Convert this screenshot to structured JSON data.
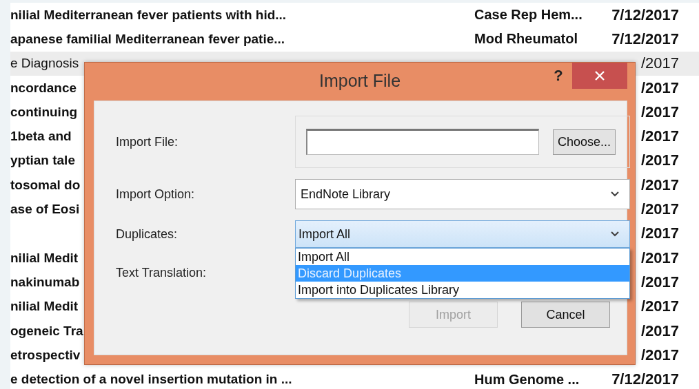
{
  "reference_list": {
    "rows": [
      {
        "title": "nilial Mediterranean fever patients with hid...",
        "journal": "Case Rep Hem...",
        "date": "7/12/2017",
        "selected": false,
        "unread": true
      },
      {
        "title": "apanese familial Mediterranean fever patie...",
        "journal": "Mod Rheumatol",
        "date": "7/12/2017",
        "selected": false,
        "unread": true
      },
      {
        "title": "e Diagnosis",
        "date": "/2017",
        "selected": true,
        "unread": false
      },
      {
        "title": "ncordance",
        "date": "/2017",
        "selected": false,
        "unread": true
      },
      {
        "title": "continuing",
        "date": "/2017",
        "selected": false,
        "unread": true
      },
      {
        "title": "1beta and",
        "date": "/2017",
        "selected": false,
        "unread": true
      },
      {
        "title": "yptian tale",
        "date": "/2017",
        "selected": false,
        "unread": true
      },
      {
        "title": "tosomal do",
        "date": "/2017",
        "selected": false,
        "unread": true
      },
      {
        "title": "ase of Eosi",
        "date": "/2017",
        "selected": false,
        "unread": true
      },
      {
        "date": "/2017",
        "selected": false,
        "unread": true
      },
      {
        "title": "nilial Medit",
        "date": "/2017",
        "selected": false,
        "unread": true
      },
      {
        "title": "nakinumab",
        "date": "/2017",
        "selected": false,
        "unread": true
      },
      {
        "title": "nilial Medit",
        "date": "/2017",
        "selected": false,
        "unread": true
      },
      {
        "title": "ogeneic Tra",
        "date": "/2017",
        "selected": false,
        "unread": true
      },
      {
        "title": "etrospectiv",
        "date": "/2017",
        "selected": false,
        "unread": true
      },
      {
        "title": "e detection of a novel insertion mutation in ...",
        "journal": "Hum Genome ...",
        "date": "7/12/2017",
        "selected": false,
        "unread": true
      }
    ]
  },
  "dialog": {
    "title": "Import File",
    "help": "?",
    "import_file": {
      "label": "Import File:",
      "button": "Choose..."
    },
    "import_option": {
      "label": "Import Option:",
      "value": "EndNote Library"
    },
    "duplicates": {
      "label": "Duplicates:",
      "value": "Import All",
      "expanded": true,
      "options": [
        {
          "label": "Import All",
          "highlighted": false
        },
        {
          "label": "Discard Duplicates",
          "highlighted": true
        },
        {
          "label": "Import into Duplicates Library",
          "highlighted": false
        }
      ]
    },
    "text_translation": {
      "label": "Text Translation:"
    },
    "buttons": [
      {
        "label": "Import",
        "disabled": true
      },
      {
        "label": "Cancel",
        "disabled": false
      }
    ]
  }
}
